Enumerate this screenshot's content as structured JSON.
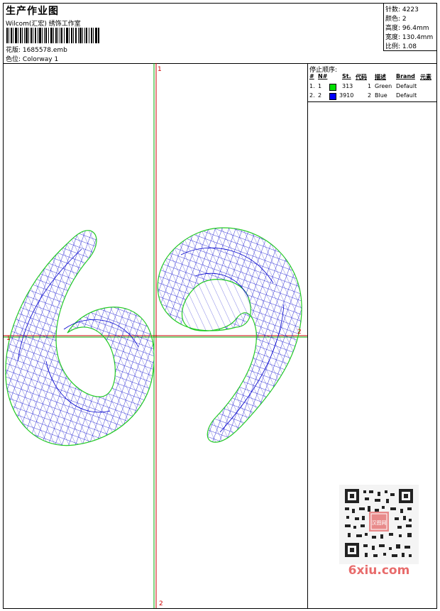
{
  "header": {
    "title": "生产作业图",
    "studio": "Wilcom(汇宏) 绣饰工作室",
    "file_label": "花版:",
    "file_value": "1685578.emb",
    "colorway_label": "色位:",
    "colorway_value": "Colorway 1"
  },
  "stats": [
    {
      "label": "针数:",
      "value": "4223"
    },
    {
      "label": "颜色:",
      "value": "2"
    },
    {
      "label": "高度:",
      "value": "96.4mm"
    },
    {
      "label": "宽度:",
      "value": "130.4mm"
    },
    {
      "label": "比例:",
      "value": "1.08"
    }
  ],
  "stop_sequence": {
    "title": "停止顺序:",
    "headers": {
      "num": "#",
      "needle": "N#",
      "stitches": "St.",
      "code": "代码",
      "desc": "描述",
      "brand": "Brand",
      "element": "元素"
    },
    "rows": [
      {
        "num": "1.",
        "needle": "1",
        "color": "#00e000",
        "stitches": "313",
        "code": "1",
        "desc": "Green",
        "brand": "Default"
      },
      {
        "num": "2.",
        "needle": "2",
        "color": "#0000ff",
        "stitches": "3910",
        "code": "2",
        "desc": "Blue",
        "brand": "Default"
      }
    ]
  },
  "design": {
    "axis_labels": {
      "top": "1",
      "bottom": "2",
      "left": "1",
      "right": "2"
    },
    "outline_color": "#22cc22",
    "fill_color": "#0000cc",
    "guide_color_vertical": "#00aa00",
    "guide_color_horizontal": "#cc0000"
  },
  "watermark": {
    "seal_text": "汉图网",
    "site": "6xiu.com"
  }
}
